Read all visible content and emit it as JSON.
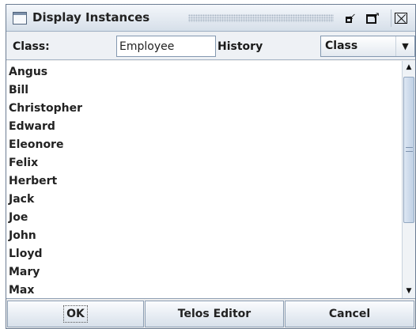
{
  "window": {
    "title": "Display Instances",
    "controls": {
      "iconify": "iconify-icon",
      "maximize": "maximize-icon",
      "close": "close-icon"
    }
  },
  "toolbar": {
    "class_label": "Class:",
    "class_value": "Employee",
    "history_label": "History",
    "select": {
      "value": "Class",
      "arrow": "▼"
    }
  },
  "instances": [
    "Angus",
    "Bill",
    "Christopher",
    "Edward",
    "Eleonore",
    "Felix",
    "Herbert",
    "Jack",
    "Joe",
    "John",
    "Lloyd",
    "Mary",
    "Max"
  ],
  "scrollbar": {
    "up": "▲",
    "down": "▼"
  },
  "buttons": {
    "ok": "OK",
    "telos_editor": "Telos Editor",
    "cancel": "Cancel"
  }
}
